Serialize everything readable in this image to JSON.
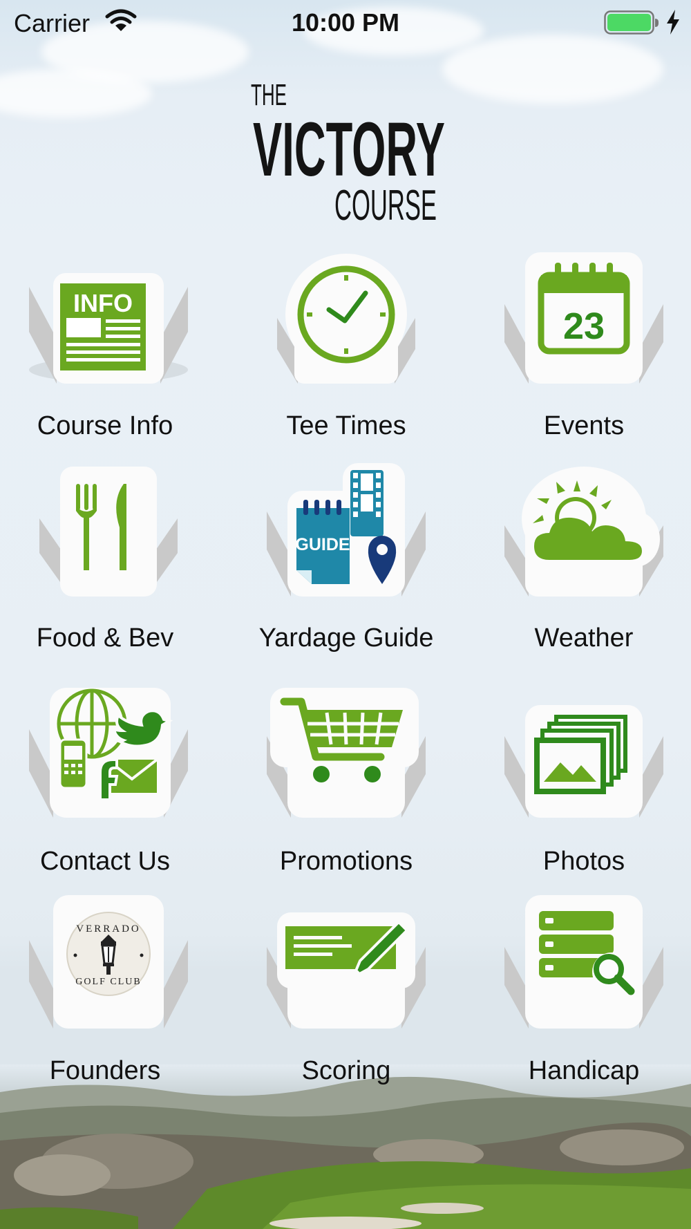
{
  "status_bar": {
    "carrier": "Carrier",
    "time": "10:00 PM",
    "battery_color": "#4cd964"
  },
  "logo": {
    "line1": "THE",
    "line2": "VICTORY",
    "line3": "COURSE"
  },
  "colors": {
    "accent_green": "#6aa820",
    "dark_green": "#2f8a1c",
    "guide_blue": "#1f88a8",
    "pin_navy": "#183a7a"
  },
  "menu": [
    {
      "label": "Course Info",
      "icon": "info-newspaper-icon"
    },
    {
      "label": "Tee Times",
      "icon": "clock-icon"
    },
    {
      "label": "Events",
      "icon": "calendar-icon",
      "icon_text": "23"
    },
    {
      "label": "Food & Bev",
      "icon": "fork-knife-icon"
    },
    {
      "label": "Yardage Guide",
      "icon": "guide-map-icon",
      "icon_text": "GUIDE"
    },
    {
      "label": "Weather",
      "icon": "sun-cloud-icon"
    },
    {
      "label": "Contact Us",
      "icon": "contact-social-icon"
    },
    {
      "label": "Promotions",
      "icon": "shopping-cart-icon"
    },
    {
      "label": "Photos",
      "icon": "photos-icon"
    },
    {
      "label": "Founders",
      "icon": "verrado-seal-icon",
      "icon_text_top": "VERRADO",
      "icon_text_bottom": "GOLF CLUB"
    },
    {
      "label": "Scoring",
      "icon": "scorecard-pencil-icon"
    },
    {
      "label": "Handicap",
      "icon": "database-search-icon"
    }
  ]
}
